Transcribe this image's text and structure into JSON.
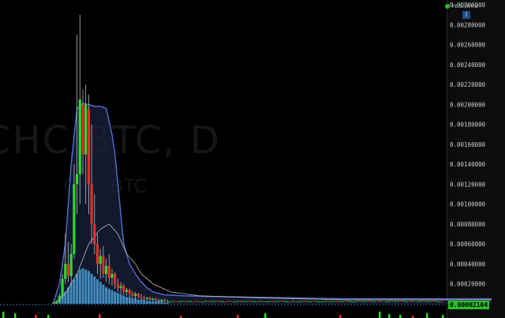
{
  "status": {
    "label": "realtime"
  },
  "watermark": {
    "symbol": "CHC/BTC, D",
    "pair": "CHC/BTC"
  },
  "colors": {
    "background": "#000000",
    "up": "#2bdc2b",
    "down": "#e0302a",
    "band": "#4f69c9",
    "band_fill": "#1a2340",
    "volume": "#4aa0d8",
    "ma": "#bbbbbb",
    "last_price_bg": "#2bbd2b"
  },
  "icons": {
    "info": "info-icon",
    "status_dot": "status-dot"
  },
  "chart_data": {
    "type": "candlestick",
    "ylim": [
      0,
      0.003
    ],
    "y_ticks": [
      "0.00300000",
      "0.00280000",
      "0.00260000",
      "0.00240000",
      "0.00220000",
      "0.00200000",
      "0.00180000",
      "0.00160000",
      "0.00140000",
      "0.00120000",
      "0.00100000",
      "0.00080000",
      "0.00060000",
      "0.00040000",
      "0.00020000"
    ],
    "last_price": "0.00002104",
    "candles": [
      {
        "o": 0.0,
        "h": 2e-05,
        "l": 0.0,
        "c": 1e-05
      },
      {
        "o": 1e-05,
        "h": 3e-05,
        "l": 0.0,
        "c": 2e-05
      },
      {
        "o": 2e-05,
        "h": 0.0001,
        "l": 1e-05,
        "c": 8e-05
      },
      {
        "o": 8e-05,
        "h": 0.0003,
        "l": 5e-05,
        "c": 0.00025
      },
      {
        "o": 0.00025,
        "h": 0.0007,
        "l": 0.0002,
        "c": 0.0004
      },
      {
        "o": 0.0004,
        "h": 0.00062,
        "l": 0.00022,
        "c": 0.00028
      },
      {
        "o": 0.00028,
        "h": 0.0006,
        "l": 0.0002,
        "c": 0.0005
      },
      {
        "o": 0.0005,
        "h": 0.0014,
        "l": 0.00045,
        "c": 0.0012
      },
      {
        "o": 0.0012,
        "h": 0.0027,
        "l": 0.0009,
        "c": 0.0013
      },
      {
        "o": 0.0013,
        "h": 0.0029,
        "l": 0.001,
        "c": 0.00205
      },
      {
        "o": 0.002,
        "h": 0.00215,
        "l": 0.0013,
        "c": 0.0015
      },
      {
        "o": 0.0015,
        "h": 0.0022,
        "l": 0.001,
        "c": 0.002
      },
      {
        "o": 0.00195,
        "h": 0.0021,
        "l": 0.0009,
        "c": 0.0012
      },
      {
        "o": 0.0012,
        "h": 0.0018,
        "l": 0.0006,
        "c": 0.0008
      },
      {
        "o": 0.0008,
        "h": 0.0011,
        "l": 0.0005,
        "c": 0.0006
      },
      {
        "o": 0.0006,
        "h": 0.0007,
        "l": 0.0003,
        "c": 0.0004
      },
      {
        "o": 0.0004,
        "h": 0.00055,
        "l": 0.00025,
        "c": 0.00048
      },
      {
        "o": 0.00048,
        "h": 0.00058,
        "l": 0.00026,
        "c": 0.0003
      },
      {
        "o": 0.0003,
        "h": 0.00045,
        "l": 0.00022,
        "c": 0.00038
      },
      {
        "o": 0.00038,
        "h": 0.0005,
        "l": 0.0002,
        "c": 0.00026
      },
      {
        "o": 0.00026,
        "h": 0.00035,
        "l": 0.00018,
        "c": 0.0003
      },
      {
        "o": 0.0003,
        "h": 0.00032,
        "l": 0.00015,
        "c": 0.0002
      },
      {
        "o": 0.0002,
        "h": 0.00025,
        "l": 0.00012,
        "c": 0.00016
      },
      {
        "o": 0.00016,
        "h": 0.00022,
        "l": 0.0001,
        "c": 0.00018
      },
      {
        "o": 0.00018,
        "h": 0.0002,
        "l": 9e-05,
        "c": 0.00012
      },
      {
        "o": 0.00012,
        "h": 0.00016,
        "l": 8e-05,
        "c": 0.00014
      },
      {
        "o": 0.00014,
        "h": 0.00015,
        "l": 7e-05,
        "c": 0.0001
      },
      {
        "o": 0.0001,
        "h": 0.00013,
        "l": 6e-05,
        "c": 8e-05
      },
      {
        "o": 8e-05,
        "h": 0.00012,
        "l": 5e-05,
        "c": 0.0001
      },
      {
        "o": 0.0001,
        "h": 0.00011,
        "l": 5e-05,
        "c": 7e-05
      },
      {
        "o": 7e-05,
        "h": 0.0001,
        "l": 4e-05,
        "c": 6e-05
      },
      {
        "o": 6e-05,
        "h": 8e-05,
        "l": 4e-05,
        "c": 5e-05
      },
      {
        "o": 5e-05,
        "h": 7e-05,
        "l": 3e-05,
        "c": 6e-05
      },
      {
        "o": 6e-05,
        "h": 7e-05,
        "l": 3e-05,
        "c": 4e-05
      },
      {
        "o": 4e-05,
        "h": 6e-05,
        "l": 3e-05,
        "c": 5e-05
      },
      {
        "o": 5e-05,
        "h": 6e-05,
        "l": 3e-05,
        "c": 4e-05
      },
      {
        "o": 4e-05,
        "h": 5e-05,
        "l": 2e-05,
        "c": 3e-05
      },
      {
        "o": 3e-05,
        "h": 5e-05,
        "l": 2e-05,
        "c": 4e-05
      },
      {
        "o": 4e-05,
        "h": 5e-05,
        "l": 2e-05,
        "c": 3e-05
      },
      {
        "o": 3e-05,
        "h": 4e-05,
        "l": 2e-05,
        "c": 3e-05
      }
    ],
    "flat_segment": {
      "value": 2.5e-05,
      "variation": 1e-05
    },
    "band_upper": [
      [
        0,
        2e-05
      ],
      [
        2,
        0.0002
      ],
      [
        4,
        0.0006
      ],
      [
        6,
        0.0014
      ],
      [
        8,
        0.00196
      ],
      [
        10,
        0.00201
      ],
      [
        12,
        0.002
      ],
      [
        14,
        0.00198
      ],
      [
        16,
        0.00198
      ],
      [
        18,
        0.00196
      ],
      [
        20,
        0.0017
      ],
      [
        21,
        0.0015
      ],
      [
        22,
        0.0012
      ],
      [
        23,
        0.0009
      ],
      [
        24,
        0.0006
      ],
      [
        26,
        0.0004
      ],
      [
        28,
        0.0003
      ],
      [
        30,
        0.00022
      ],
      [
        32,
        0.00016
      ],
      [
        34,
        0.00012
      ],
      [
        38,
        9e-05
      ],
      [
        45,
        8e-05
      ],
      [
        60,
        7e-05
      ],
      [
        80,
        6e-05
      ],
      [
        100,
        5e-05
      ],
      [
        120,
        5e-05
      ],
      [
        150,
        5e-05
      ]
    ],
    "band_lower": [
      [
        0,
        0.0
      ],
      [
        10,
        0.0
      ],
      [
        150,
        0.0
      ]
    ],
    "ma_line": [
      [
        0,
        0.0
      ],
      [
        4,
        0.0001
      ],
      [
        8,
        0.0003
      ],
      [
        12,
        0.0006
      ],
      [
        16,
        0.00075
      ],
      [
        19,
        0.0008
      ],
      [
        22,
        0.0007
      ],
      [
        25,
        0.0005
      ],
      [
        28,
        0.0004
      ],
      [
        30,
        0.0003
      ],
      [
        34,
        0.0002
      ],
      [
        40,
        0.00012
      ],
      [
        50,
        8e-05
      ],
      [
        70,
        6e-05
      ],
      [
        100,
        4e-05
      ],
      [
        150,
        4e-05
      ]
    ],
    "volume": [
      1,
      2,
      4,
      6,
      9,
      12,
      15,
      18,
      22,
      25,
      26,
      25,
      24,
      22,
      20,
      18,
      16,
      14,
      12,
      11,
      10,
      9,
      8,
      7,
      6,
      5,
      5,
      4,
      4,
      3,
      3,
      3,
      2,
      2,
      2,
      2,
      2,
      2,
      1,
      1
    ]
  }
}
